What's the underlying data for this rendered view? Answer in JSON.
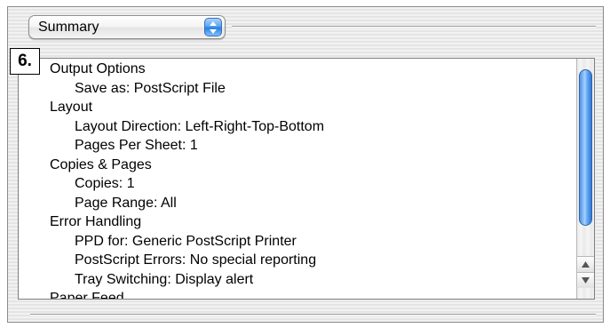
{
  "popup": {
    "selected": "Summary",
    "icon": "popup-arrows-icon"
  },
  "step": "6.",
  "summary": [
    {
      "text": "Output Options",
      "level": 1
    },
    {
      "text": "Save as:  PostScript File",
      "level": 2
    },
    {
      "text": "Layout",
      "level": 1
    },
    {
      "text": "Layout Direction:  Left-Right-Top-Bottom",
      "level": 2
    },
    {
      "text": "Pages Per Sheet:  1",
      "level": 2
    },
    {
      "text": "Copies & Pages",
      "level": 1
    },
    {
      "text": "Copies:  1",
      "level": 2
    },
    {
      "text": "Page Range:  All",
      "level": 2
    },
    {
      "text": "Error Handling",
      "level": 1
    },
    {
      "text": "PPD for:  Generic PostScript Printer",
      "level": 2
    },
    {
      "text": "PostScript Errors:  No special reporting",
      "level": 2
    },
    {
      "text": "Tray Switching:  Display alert",
      "level": 2
    },
    {
      "text": "Paper Feed",
      "level": 1
    }
  ],
  "colors": {
    "accent": "#2a7fe0",
    "scroll_thumb": "#6aaff6"
  }
}
